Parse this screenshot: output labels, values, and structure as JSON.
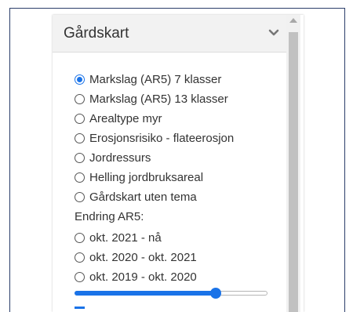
{
  "panel": {
    "title": "Gårdskart",
    "collapse_icon": "chevron-down-icon"
  },
  "layers": [
    {
      "label": "Markslag (AR5) 7 klasser",
      "checked": true
    },
    {
      "label": "Markslag (AR5) 13 klasser",
      "checked": false
    },
    {
      "label": "Arealtype myr",
      "checked": false
    },
    {
      "label": "Erosjonsrisiko - flateerosjon",
      "checked": false
    },
    {
      "label": "Jordressurs",
      "checked": false
    },
    {
      "label": "Helling jordbruksareal",
      "checked": false
    },
    {
      "label": "Gårdskart uten tema",
      "checked": false
    }
  ],
  "change_section": {
    "label": "Endring AR5:",
    "periods": [
      {
        "label": "okt. 2021 - nå",
        "checked": false
      },
      {
        "label": "okt. 2020 - okt. 2021",
        "checked": false
      },
      {
        "label": "okt. 2019 - okt. 2020",
        "checked": false
      }
    ]
  },
  "opacity_slider": {
    "value": 0.73
  },
  "colors": {
    "accent": "#1a73e8",
    "header_bg": "#f2f2f2",
    "text": "#333333",
    "frame_border": "#2b3e6a"
  }
}
